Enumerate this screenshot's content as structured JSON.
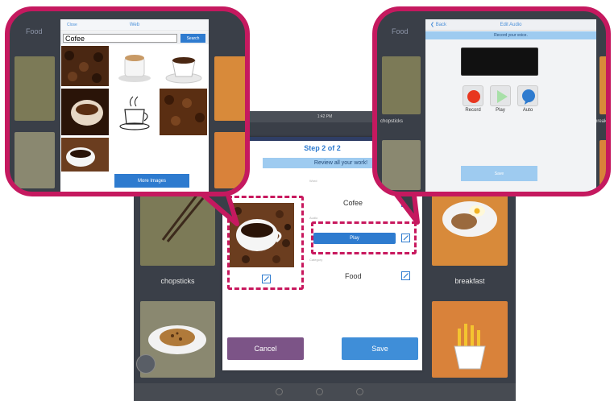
{
  "tablet": {
    "status_time": "1:42 PM",
    "tiles": {
      "chopsticks": "chopsticks",
      "breakfast": "breakfast"
    }
  },
  "dialog": {
    "step_title": "Step 2 of 2",
    "review_text": "Review all your work!",
    "word_label": "Word",
    "word_value": "Cofee",
    "audio_label": "Audio",
    "play_label": "Play",
    "category_label": "Category",
    "category_value": "Food",
    "cancel_label": "Cancel",
    "save_label": "Save"
  },
  "web_search": {
    "close_label": "Close",
    "title": "Web",
    "query": "Cofee",
    "search_label": "Search",
    "more_images_label": "More Images",
    "background_label": "Food"
  },
  "edit_audio": {
    "back_label": "Back",
    "title": "Edit Audio",
    "instruction": "Record your voice.",
    "record_label": "Record",
    "play_label": "Play",
    "auto_label": "Auto",
    "save_label": "Save",
    "background_left_label": "Food",
    "chopsticks_label": "chopsticks",
    "breakfast_label": "breakfast"
  },
  "colors": {
    "highlight": "#c5195f",
    "accent_blue": "#2e7bcf",
    "cancel_purple": "#7c5487",
    "step_title_blue": "#2e7bcf"
  }
}
